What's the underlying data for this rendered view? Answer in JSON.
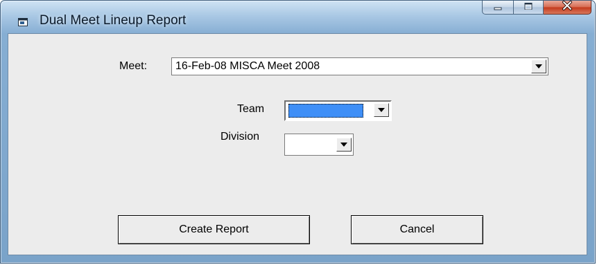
{
  "window": {
    "title": "Dual Meet Lineup Report"
  },
  "form": {
    "meet": {
      "label": "Meet:",
      "value": "16-Feb-08 MISCA Meet 2008"
    },
    "team": {
      "label": "Team",
      "value": ""
    },
    "division": {
      "label": "Division",
      "value": ""
    }
  },
  "buttons": {
    "create_report": "Create Report",
    "cancel": "Cancel"
  },
  "colors": {
    "team_selection": "#3f8ff7",
    "dialog_bg": "#ececec"
  }
}
